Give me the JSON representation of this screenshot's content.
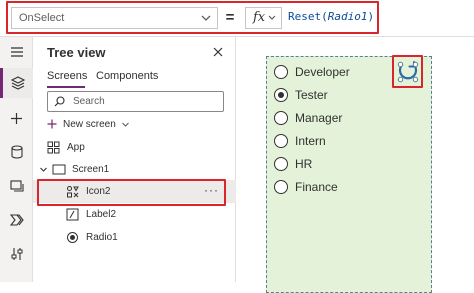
{
  "formula_bar": {
    "property": "OnSelect",
    "equals": "=",
    "fx_label": "fx",
    "formula_fn": "Reset",
    "formula_open": "(",
    "formula_arg": "Radio1",
    "formula_close": ")"
  },
  "rail": {
    "items": [
      {
        "icon": "hamburger-icon"
      },
      {
        "icon": "layers-icon",
        "active": true
      },
      {
        "icon": "plus-icon"
      },
      {
        "icon": "database-icon"
      },
      {
        "icon": "media-icon"
      },
      {
        "icon": "power-automate-icon"
      },
      {
        "icon": "advanced-tools-icon"
      }
    ]
  },
  "tree_view": {
    "title": "Tree view",
    "tabs": {
      "screens": "Screens",
      "components": "Components"
    },
    "search_placeholder": "Search",
    "new_screen": "New screen",
    "items": {
      "app": "App",
      "screen1": "Screen1",
      "icon2": "Icon2",
      "label2": "Label2",
      "radio1": "Radio1"
    },
    "more": "···"
  },
  "canvas": {
    "radio_options": [
      "Developer",
      "Tester",
      "Manager",
      "Intern",
      "HR",
      "Finance"
    ],
    "selected_option": "Tester",
    "group_fill": "#e3f2d8"
  },
  "colors": {
    "accent": "#742774",
    "highlight": "#d9262b",
    "formula": "#0b4a9b"
  }
}
